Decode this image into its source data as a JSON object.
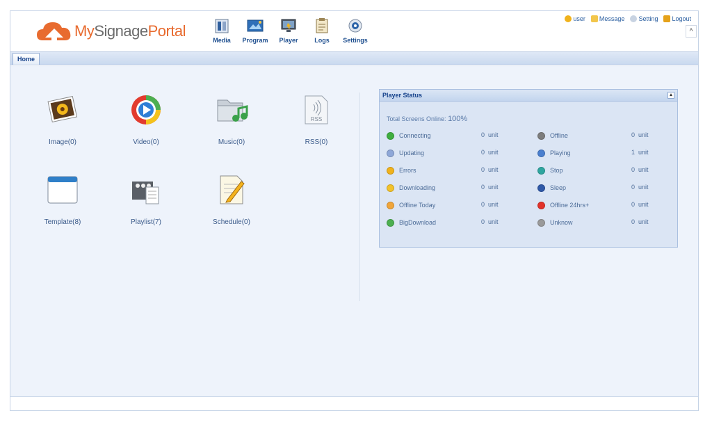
{
  "logo": {
    "my": "My",
    "signage": "Signage",
    "portal": "Portal"
  },
  "nav": [
    {
      "label": "Media",
      "icon": "media-icon"
    },
    {
      "label": "Program",
      "icon": "program-icon"
    },
    {
      "label": "Player",
      "icon": "player-icon"
    },
    {
      "label": "Logs",
      "icon": "logs-icon"
    },
    {
      "label": "Settings",
      "icon": "settings-icon"
    }
  ],
  "userbar": {
    "user": "user",
    "message": "Message",
    "setting": "Setting",
    "logout": "Logout"
  },
  "collapse_glyph": "^",
  "tabs": {
    "home": "Home"
  },
  "tiles": [
    {
      "label": "Image(0)",
      "icon": "image-icon"
    },
    {
      "label": "Video(0)",
      "icon": "video-icon"
    },
    {
      "label": "Music(0)",
      "icon": "music-icon"
    },
    {
      "label": "RSS(0)",
      "icon": "rss-icon",
      "badge": "RSS"
    },
    {
      "label": "Template(8)",
      "icon": "template-icon"
    },
    {
      "label": "Playlist(7)",
      "icon": "playlist-icon"
    },
    {
      "label": "Schedule(0)",
      "icon": "schedule-icon"
    }
  ],
  "player_status": {
    "title": "Player Status",
    "toggle": "▴",
    "total_label": "Total Screens Online:",
    "total_value": "100%",
    "unit": "unit",
    "left": [
      {
        "label": "Connecting",
        "count": "0",
        "color": "#3fae3f"
      },
      {
        "label": "Updating",
        "count": "0",
        "color": "#8ea7d8"
      },
      {
        "label": "Errors",
        "count": "0",
        "color": "#f0b21c"
      },
      {
        "label": "Downloading",
        "count": "0",
        "color": "#f2c22b"
      },
      {
        "label": "Offline Today",
        "count": "0",
        "color": "#f0a53a"
      },
      {
        "label": "BigDownload",
        "count": "0",
        "color": "#4caf50"
      }
    ],
    "right": [
      {
        "label": "Offline",
        "count": "0",
        "color": "#7d7d7d"
      },
      {
        "label": "Playing",
        "count": "1",
        "color": "#4a7fcf"
      },
      {
        "label": "Stop",
        "count": "0",
        "color": "#2fa6a0"
      },
      {
        "label": "Sleep",
        "count": "0",
        "color": "#2f59a8"
      },
      {
        "label": "Offline 24hrs+",
        "count": "0",
        "color": "#e2332b"
      },
      {
        "label": "Unknow",
        "count": "0",
        "color": "#9a9a9a"
      }
    ]
  },
  "colors": {
    "accent": "#e86b2f",
    "link": "#2a5ea0",
    "panel": "#dbe5f4"
  }
}
